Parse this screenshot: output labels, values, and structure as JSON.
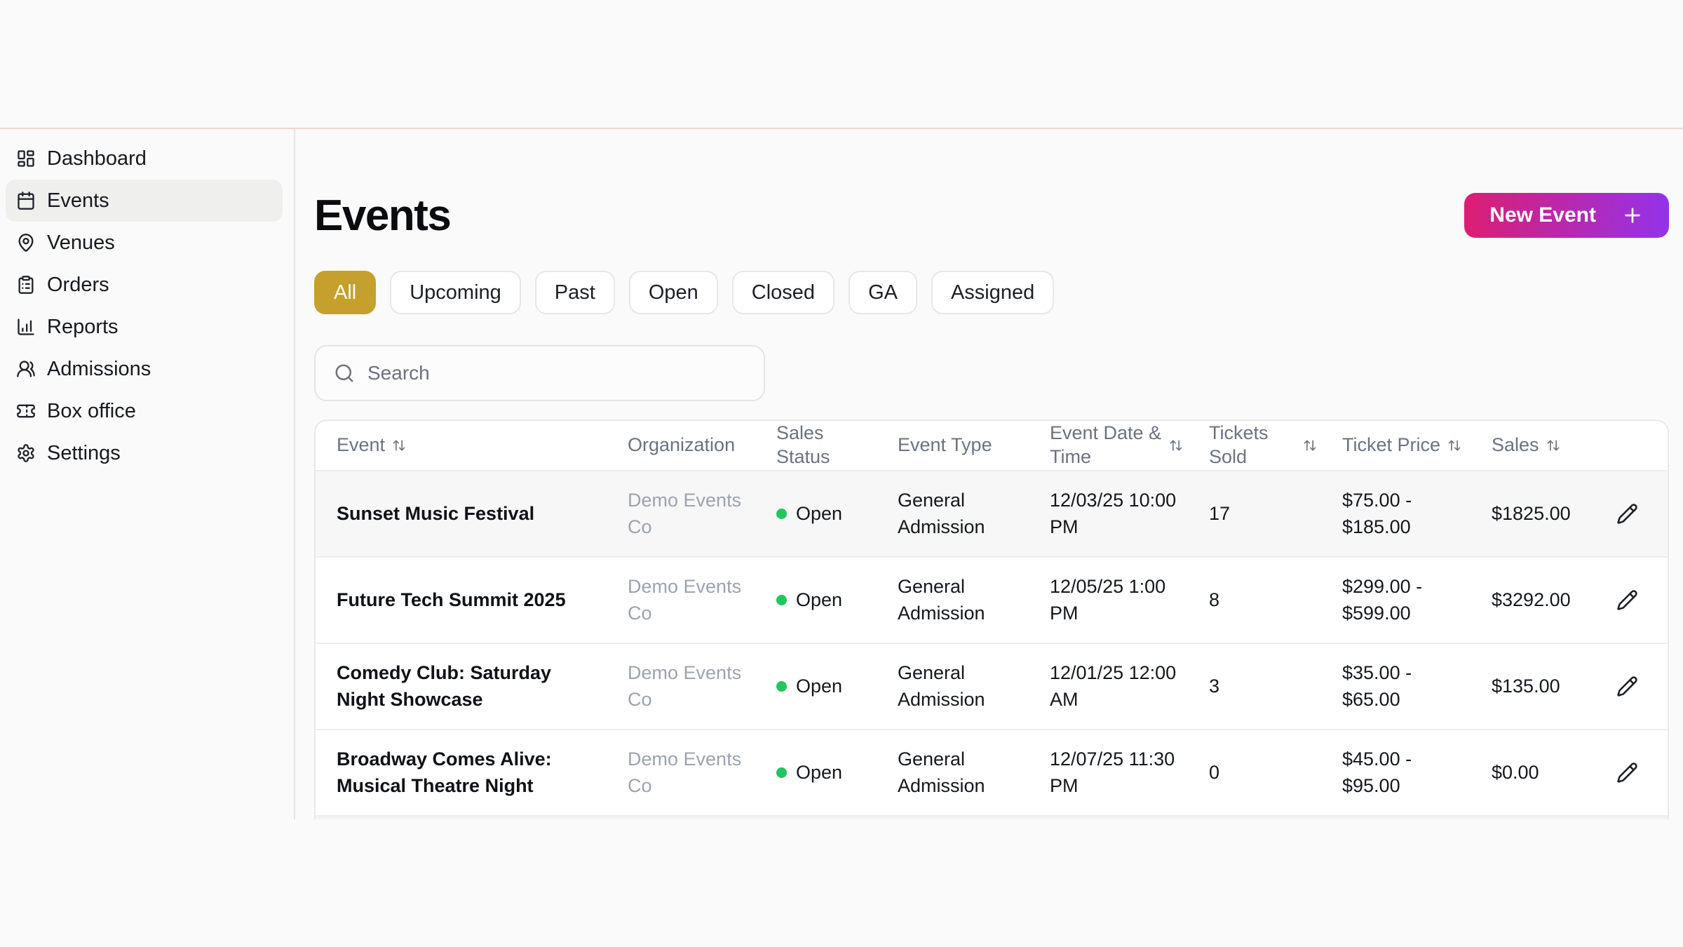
{
  "sidebar": {
    "items": [
      {
        "label": "Dashboard",
        "icon": "dashboard-icon",
        "active": false
      },
      {
        "label": "Events",
        "icon": "calendar-icon",
        "active": true
      },
      {
        "label": "Venues",
        "icon": "map-pin-icon",
        "active": false
      },
      {
        "label": "Orders",
        "icon": "clipboard-icon",
        "active": false
      },
      {
        "label": "Reports",
        "icon": "bar-chart-icon",
        "active": false
      },
      {
        "label": "Admissions",
        "icon": "users-icon",
        "active": false
      },
      {
        "label": "Box office",
        "icon": "ticket-icon",
        "active": false
      },
      {
        "label": "Settings",
        "icon": "gear-icon",
        "active": false
      }
    ]
  },
  "header": {
    "title": "Events",
    "new_event_button": "New Event"
  },
  "filters": {
    "chips": [
      {
        "label": "All",
        "active": true
      },
      {
        "label": "Upcoming",
        "active": false
      },
      {
        "label": "Past",
        "active": false
      },
      {
        "label": "Open",
        "active": false
      },
      {
        "label": "Closed",
        "active": false
      },
      {
        "label": "GA",
        "active": false
      },
      {
        "label": "Assigned",
        "active": false
      }
    ]
  },
  "search": {
    "placeholder": "Search"
  },
  "table": {
    "columns": [
      {
        "label": "Event",
        "sortable": true
      },
      {
        "label": "Organization",
        "sortable": false
      },
      {
        "label": "Sales Status",
        "sortable": false
      },
      {
        "label": "Event Type",
        "sortable": false
      },
      {
        "label": "Event Date & Time",
        "sortable": true
      },
      {
        "label": "Tickets Sold",
        "sortable": true
      },
      {
        "label": "Ticket Price",
        "sortable": true
      },
      {
        "label": "Sales",
        "sortable": true
      }
    ],
    "rows": [
      {
        "event": "Sunset Music Festival",
        "organization": "Demo Events Co",
        "sales_status": "Open",
        "event_type": "General Admission",
        "event_datetime": "12/03/25 10:00 PM",
        "tickets_sold": "17",
        "ticket_price": "$75.00 - $185.00",
        "sales": "$1825.00"
      },
      {
        "event": "Future Tech Summit 2025",
        "organization": "Demo Events Co",
        "sales_status": "Open",
        "event_type": "General Admission",
        "event_datetime": "12/05/25 1:00 PM",
        "tickets_sold": "8",
        "ticket_price": "$299.00 - $599.00",
        "sales": "$3292.00"
      },
      {
        "event": "Comedy Club: Saturday Night Showcase",
        "organization": "Demo Events Co",
        "sales_status": "Open",
        "event_type": "General Admission",
        "event_datetime": "12/01/25 12:00 AM",
        "tickets_sold": "3",
        "ticket_price": "$35.00 - $65.00",
        "sales": "$135.00"
      },
      {
        "event": "Broadway Comes Alive: Musical Theatre Night",
        "organization": "Demo Events Co",
        "sales_status": "Open",
        "event_type": "General Admission",
        "event_datetime": "12/07/25 11:30 PM",
        "tickets_sold": "0",
        "ticket_price": "$45.00 - $95.00",
        "sales": "$0.00"
      }
    ]
  },
  "colors": {
    "accent_gradient_start": "#dc1e72",
    "accent_gradient_end": "#9333ea",
    "active_filter": "#c6a02c",
    "status_open": "#22c55e",
    "top_divider": "#f5d2d2"
  }
}
